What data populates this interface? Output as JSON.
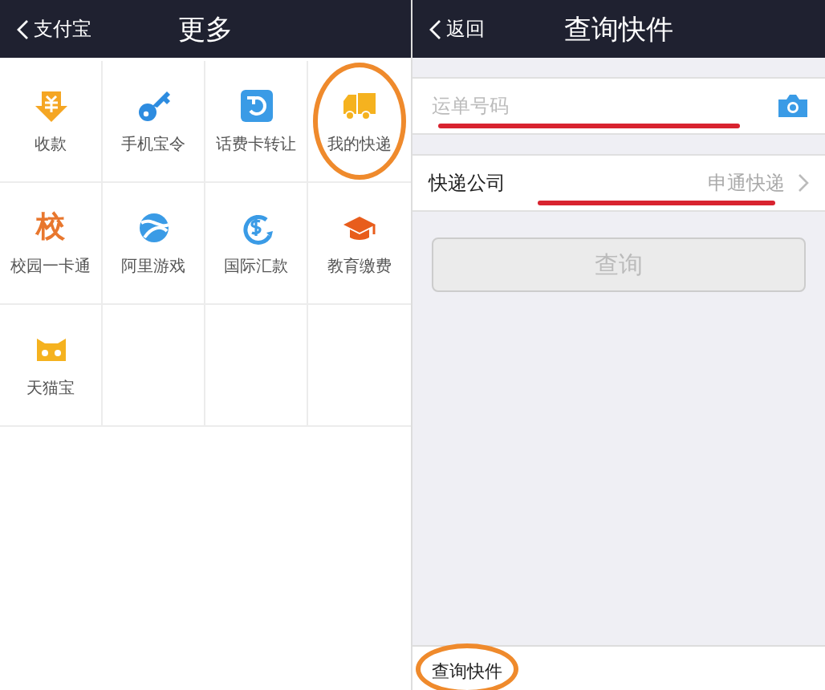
{
  "left_screen": {
    "back_label": "支付宝",
    "title": "更多",
    "grid": [
      {
        "label": "收款",
        "kind": "yuan",
        "circled": false
      },
      {
        "label": "手机宝令",
        "kind": "key",
        "circled": false
      },
      {
        "label": "话费卡转让",
        "kind": "refresh",
        "circled": false
      },
      {
        "label": "我的快递",
        "kind": "truck",
        "circled": true
      },
      {
        "label": "校园一卡通",
        "kind": "glyph",
        "glyph": "校",
        "circled": false
      },
      {
        "label": "阿里游戏",
        "kind": "ball",
        "circled": false
      },
      {
        "label": "国际汇款",
        "kind": "dollar",
        "circled": false
      },
      {
        "label": "教育缴费",
        "kind": "cap",
        "circled": false
      },
      {
        "label": "天猫宝",
        "kind": "cat",
        "circled": false
      }
    ]
  },
  "right_screen": {
    "back_label": "返回",
    "title": "查询快件",
    "tracking_field": {
      "placeholder": "运单号码",
      "struck": true
    },
    "company_row": {
      "label": "快递公司",
      "value": "申通快递",
      "struck": true
    },
    "query_button": {
      "label": "查询",
      "disabled": true
    },
    "bottom_label": {
      "text": "查询快件",
      "circled": true
    }
  }
}
